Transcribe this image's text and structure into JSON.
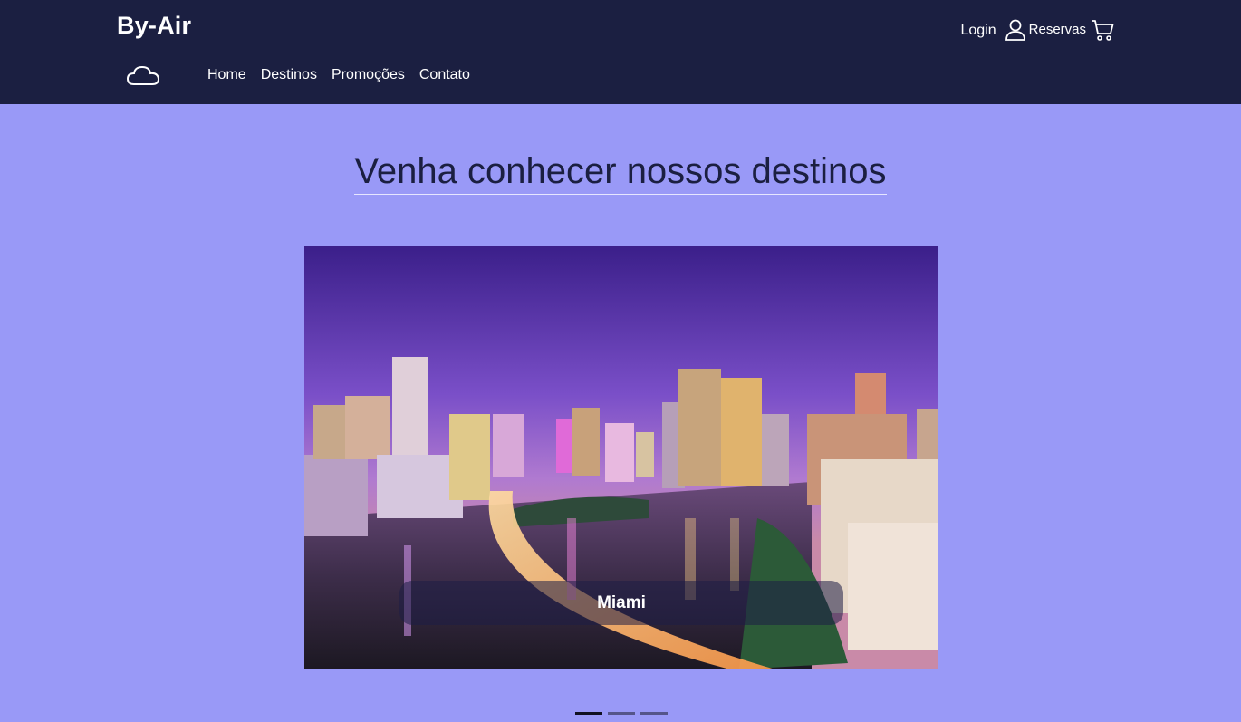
{
  "header": {
    "brand": "By-Air",
    "nav_items": [
      {
        "label": "Home"
      },
      {
        "label": "Destinos"
      },
      {
        "label": "Promoções"
      },
      {
        "label": "Contato"
      }
    ],
    "login_label": "Login",
    "reservations_label": "Reservas",
    "icons": [
      "cloud-icon",
      "user-icon",
      "cart-icon"
    ]
  },
  "main": {
    "title": "Venha conhecer nossos destinos",
    "carousel": {
      "slide_count": 3,
      "active_index": 0,
      "current_caption": "Miami"
    }
  },
  "colors": {
    "navbar_bg": "#1b1f41",
    "page_bg": "#9999f7",
    "text_dark": "#1b1f41",
    "text_light": "#ffffff"
  }
}
